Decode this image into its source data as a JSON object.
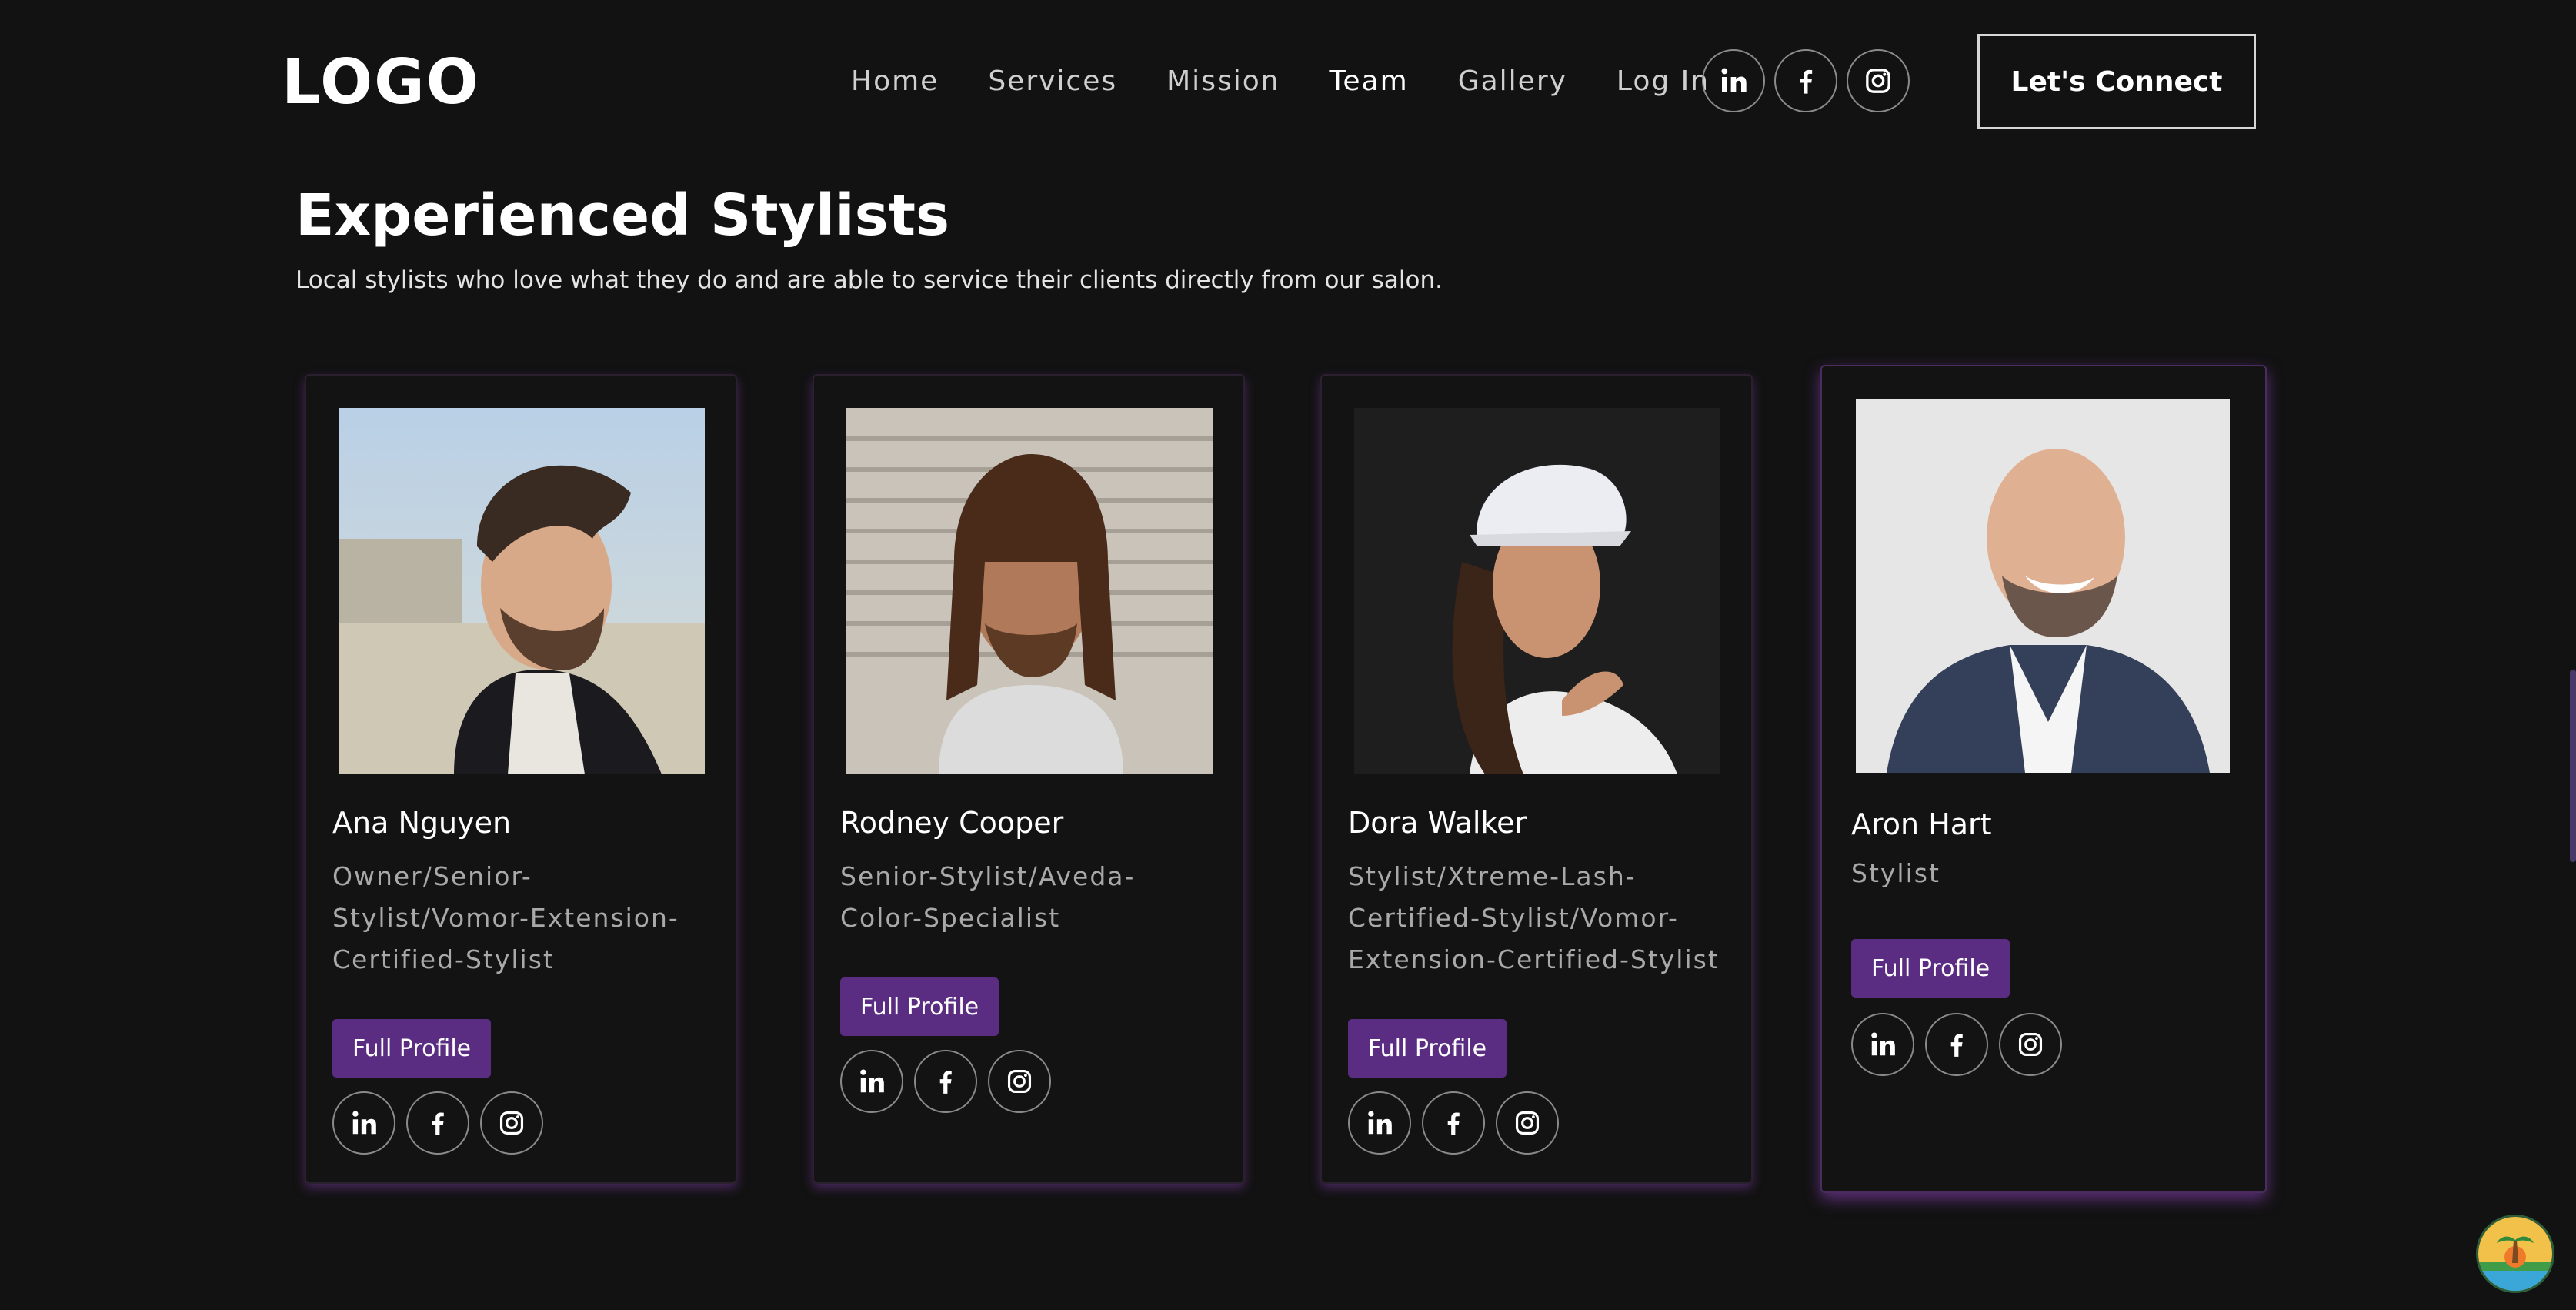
{
  "header": {
    "logo": "LOGO",
    "nav": [
      "Home",
      "Services",
      "Mission",
      "Team",
      "Gallery",
      "Log In"
    ],
    "active_nav": "Team",
    "social_icons": [
      "linkedin-icon",
      "facebook-icon",
      "instagram-icon"
    ],
    "cta_label": "Let's Connect"
  },
  "section": {
    "title": "Experienced Stylists",
    "subtitle": "Local stylists who love what they do and are able to service their clients directly from our salon."
  },
  "stylists": [
    {
      "name": "Ana Nguyen",
      "role": "Owner/Senior-Stylist/Vomor-Extension-Certified-Stylist",
      "button": "Full Profile"
    },
    {
      "name": "Rodney Cooper",
      "role": "Senior-Stylist/Aveda-Color-Specialist",
      "button": "Full Profile"
    },
    {
      "name": "Dora Walker",
      "role": "Stylist/Xtreme-Lash-Certified-Stylist/Vomor-Extension-Certified-Stylist",
      "button": "Full Profile"
    },
    {
      "name": "Aron Hart",
      "role": "Stylist",
      "button": "Full Profile"
    }
  ],
  "colors": {
    "background": "#121212",
    "accent_button": "#5a2d83",
    "card_glow": "#73379a",
    "text_muted": "#a9a9a9"
  }
}
